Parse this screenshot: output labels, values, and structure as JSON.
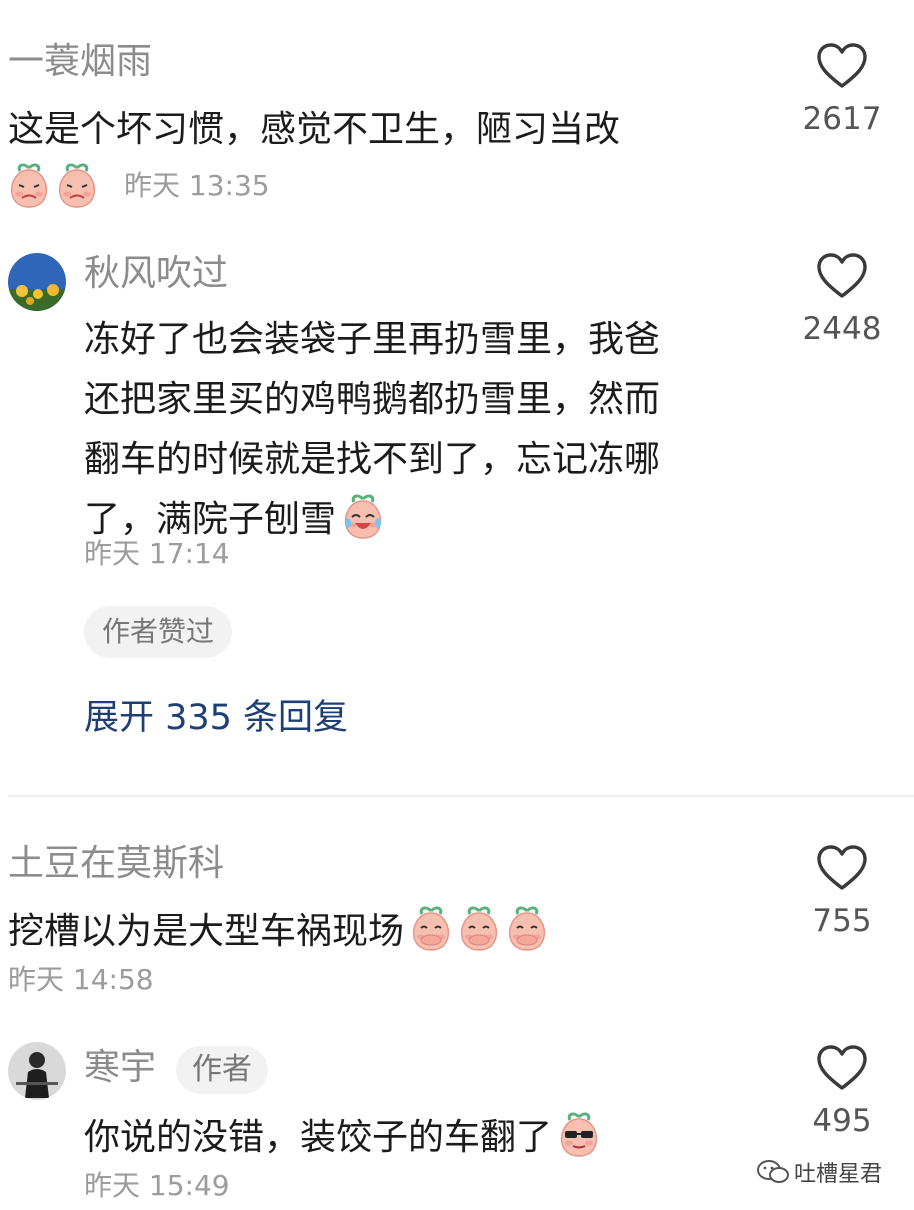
{
  "comments": [
    {
      "user": "一蓑烟雨",
      "text": "这是个坏习惯，感觉不卫生，陋习当改",
      "time": "昨天 13:35",
      "likes": "2617",
      "emoji_names": [
        "peach-cry-icon",
        "peach-cry-icon"
      ]
    },
    {
      "user": "秋风吹过",
      "lines": [
        "冻好了也会装袋子里再扔雪里，我爸",
        "还把家里买的鸡鸭鹅都扔雪里，然而",
        "翻车的时候就是找不到了，忘记冻哪",
        "了，满院子刨雪"
      ],
      "time": "昨天 17:14",
      "likes": "2448",
      "badge": "作者赞过",
      "expand": "展开 335 条回复",
      "emoji_names": [
        "peach-laugh-cry-icon"
      ]
    },
    {
      "user": "土豆在莫斯科",
      "text": "挖槽以为是大型车祸现场",
      "time": "昨天 14:58",
      "likes": "755",
      "emoji_names": [
        "peach-cover-mouth-icon",
        "peach-cover-mouth-icon",
        "peach-cover-mouth-icon"
      ]
    },
    {
      "user": "寒宇",
      "tag": "作者",
      "text": "你说的没错，装饺子的车翻了",
      "time": "昨天 15:49",
      "likes": "495",
      "emoji_names": [
        "peach-sunglasses-icon"
      ]
    }
  ],
  "watermark": {
    "text": "吐槽星君",
    "icon": "wechat-icon"
  },
  "colors": {
    "link": "#1e3f73",
    "muted": "#9c9c9c",
    "peach": "#f6b8a8"
  }
}
